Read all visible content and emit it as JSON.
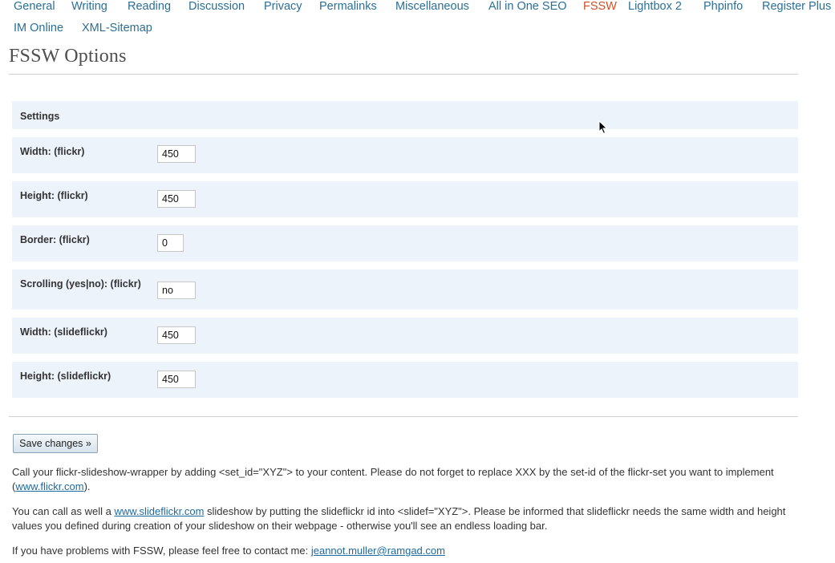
{
  "nav": {
    "tabs": [
      {
        "label": "General"
      },
      {
        "label": "Writing"
      },
      {
        "label": "Reading"
      },
      {
        "label": "Discussion"
      },
      {
        "label": "Privacy"
      },
      {
        "label": "Permalinks"
      },
      {
        "label": "Miscellaneous"
      },
      {
        "label": "All in One SEO"
      },
      {
        "label": "FSSW"
      },
      {
        "label": "Lightbox 2"
      },
      {
        "label": "Phpinfo"
      },
      {
        "label": "Register Plus"
      },
      {
        "label": "IM Online"
      },
      {
        "label": "XML-Sitemap"
      }
    ],
    "current": "FSSW"
  },
  "page": {
    "title": "FSSW Options"
  },
  "settings": {
    "header": "Settings",
    "fields": [
      {
        "label": "Width: (flickr)",
        "value": "450"
      },
      {
        "label": "Height: (flickr)",
        "value": "450"
      },
      {
        "label": "Border: (flickr)",
        "value": "0"
      },
      {
        "label": "Scrolling (yes|no): (flickr)",
        "value": "no"
      },
      {
        "label": "Width: (slideflickr)",
        "value": "450"
      },
      {
        "label": "Height: (slideflickr)",
        "value": "450"
      }
    ]
  },
  "actions": {
    "save_label": "Save changes »"
  },
  "help": {
    "p1_text": "Call your flickr-slideshow-wrapper by adding <set_id=\"XYZ\"> to your content. Please do not forget to replace XXX by the set-id of the flickr-set you want to implement (",
    "p1_link": "www.flickr.com",
    "p1_end": ").",
    "p2_start": "You can call as well a ",
    "p2_link": "www.slideflickr.com",
    "p2_text": " slideshow by putting the slideflickr id into <slidef=\"XYZ\">. Please be informed that slideflickr needs the same width and height values you defined during creation of your slideshow on their webpage - otherwise you'll see an endless loading bar.",
    "p3_text": "If you have problems with FSSW, please feel free to contact me: ",
    "p3_link": "jeannot.muller@ramgad.com"
  },
  "colors": {
    "link": "#2a6f96",
    "current_tab": "#d54e21",
    "row_background": "#edf3fb"
  }
}
